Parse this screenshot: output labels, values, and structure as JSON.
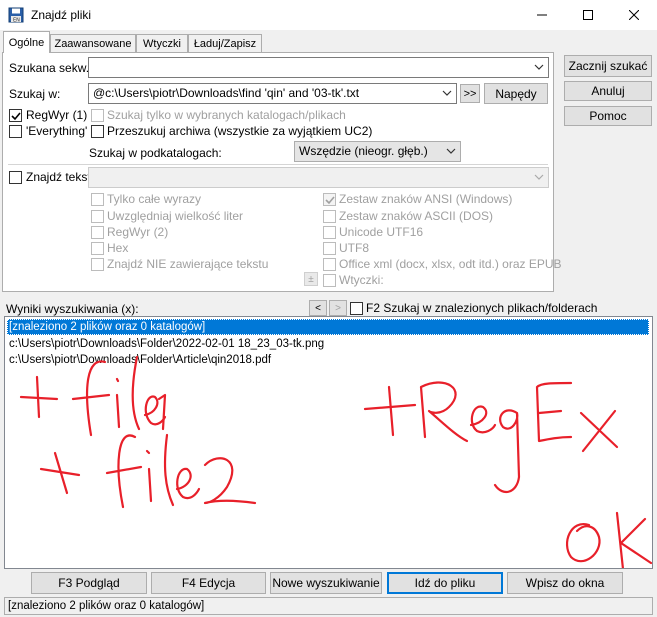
{
  "window": {
    "title": "Znajdź pliki",
    "icon": "floppy-disk-icon",
    "controls": [
      "minimize-icon",
      "maximize-icon",
      "close-icon"
    ]
  },
  "tabs": [
    "Ogólne",
    "Zaawansowane",
    "Wtyczki",
    "Ładuj/Zapisz"
  ],
  "form": {
    "search_for_label": "Szukana sekw.:",
    "search_for_value": "",
    "search_in_label": "Szukaj w:",
    "search_in_value": "@c:\\Users\\piotr\\Downloads\\find 'qin' and '03-tk'.txt",
    "browse_label": ">>",
    "drives_label": "Napędy",
    "regex_label": "RegWyr (1)",
    "regex_checked": true,
    "everything_label": "'Everything'",
    "everything_checked": false,
    "only_selected_dirs_label": "Szukaj tylko w wybranych katalogach/plikach",
    "search_archives_label": "Przeszukuj archiwa (wszystkie za wyjątkiem UC2)",
    "subdirs_label": "Szukaj w podkatalogach:",
    "subdirs_value": "Wszędzie (nieogr. głęb.)"
  },
  "find_text": {
    "label": "Znajdź tekst:",
    "checked": false,
    "value": "",
    "options_left": [
      "Tylko całe wyrazy",
      "Uwzględniaj wielkość liter",
      "RegWyr (2)",
      "Hex",
      "Znajdź NIE zawierające tekstu"
    ],
    "options_right": [
      "Zestaw znaków ANSI (Windows)",
      "Zestaw znaków ASCII (DOS)",
      "Unicode UTF16",
      "UTF8",
      "Office xml (docx, xlsx, odt itd.) oraz EPUB"
    ],
    "ansi_checked": true,
    "plugins_label": "Wtyczki:",
    "plus_label": "±"
  },
  "side_buttons": {
    "start": "Zacznij szukać",
    "cancel": "Anuluj",
    "help": "Pomoc"
  },
  "results": {
    "label": "Wyniki wyszukiwania (x):",
    "prev": "<",
    "next": ">",
    "f2_label": "F2 Szukaj w znalezionych plikach/folderach",
    "items": [
      "[znaleziono 2 plików oraz 0 katalogów]",
      "c:\\Users\\piotr\\Downloads\\Folder\\2022-02-01 18_23_03-tk.png",
      "c:\\Users\\piotr\\Downloads\\Folder\\Article\\qin2018.pdf"
    ],
    "annotations": [
      "+ file 1",
      "+ file2",
      "+ RegEx",
      "OK"
    ]
  },
  "bottom_buttons": [
    "F3 Podgląd",
    "F4 Edycja",
    "Nowe wyszukiwanie",
    "Idź do pliku",
    "Wpisz do okna"
  ],
  "status": "[znaleziono 2 plików oraz 0 katalogów]",
  "colors": {
    "accent": "#0078d7",
    "annotation": "#e8202a"
  }
}
